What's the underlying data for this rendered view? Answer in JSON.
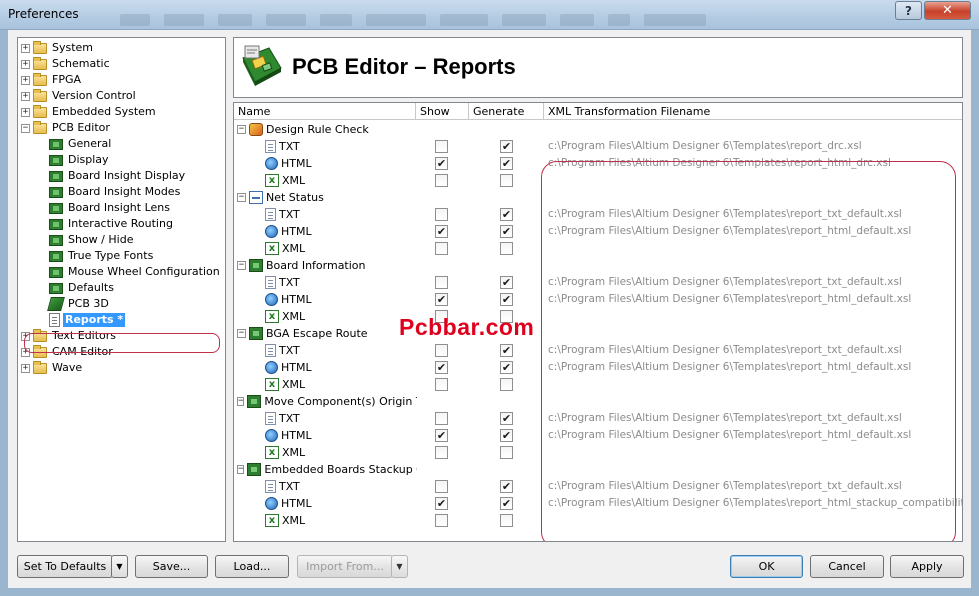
{
  "window": {
    "title": "Preferences"
  },
  "tree": {
    "items": [
      {
        "label": "System",
        "kind": "folder",
        "expander": "+",
        "depth": 0
      },
      {
        "label": "Schematic",
        "kind": "folder",
        "expander": "+",
        "depth": 0
      },
      {
        "label": "FPGA",
        "kind": "folder",
        "expander": "+",
        "depth": 0
      },
      {
        "label": "Version Control",
        "kind": "folder",
        "expander": "+",
        "depth": 0
      },
      {
        "label": "Embedded System",
        "kind": "folder",
        "expander": "+",
        "depth": 0
      },
      {
        "label": "PCB Editor",
        "kind": "folder",
        "expander": "−",
        "depth": 0
      },
      {
        "label": "General",
        "kind": "chip",
        "depth": 1
      },
      {
        "label": "Display",
        "kind": "chip",
        "depth": 1
      },
      {
        "label": "Board Insight Display",
        "kind": "chip",
        "depth": 1
      },
      {
        "label": "Board Insight Modes",
        "kind": "chip",
        "depth": 1
      },
      {
        "label": "Board Insight Lens",
        "kind": "chip",
        "depth": 1
      },
      {
        "label": "Interactive Routing",
        "kind": "chip",
        "depth": 1
      },
      {
        "label": "Show / Hide",
        "kind": "chip",
        "depth": 1
      },
      {
        "label": "True Type Fonts",
        "kind": "chip",
        "depth": 1
      },
      {
        "label": "Mouse Wheel Configuration",
        "kind": "chip",
        "depth": 1
      },
      {
        "label": "Defaults",
        "kind": "chip",
        "depth": 1
      },
      {
        "label": "PCB 3D",
        "kind": "pcb3d",
        "depth": 1
      },
      {
        "label": "Reports *",
        "kind": "doc",
        "depth": 1,
        "selected": true
      },
      {
        "label": "Text Editors",
        "kind": "folder",
        "expander": "+",
        "depth": 0
      },
      {
        "label": "CAM Editor",
        "kind": "folder",
        "expander": "+",
        "depth": 0
      },
      {
        "label": "Wave",
        "kind": "folder",
        "expander": "+",
        "depth": 0
      }
    ]
  },
  "header": {
    "title": "PCB Editor – Reports"
  },
  "grid": {
    "columns": {
      "name": "Name",
      "show": "Show",
      "generate": "Generate",
      "xml": "XML Transformation Filename"
    },
    "groups": [
      {
        "name": "Design Rule Check",
        "icon": "drc-icon",
        "rows": [
          {
            "format": "TXT",
            "show": false,
            "generate": true,
            "path": "c:\\Program Files\\Altium Designer 6\\Templates\\report_drc.xsl"
          },
          {
            "format": "HTML",
            "show": true,
            "generate": true,
            "path": "c:\\Program Files\\Altium Designer 6\\Templates\\report_html_drc.xsl"
          },
          {
            "format": "XML",
            "show": false,
            "generate": false,
            "path": ""
          }
        ]
      },
      {
        "name": "Net Status",
        "icon": "net-status-icon",
        "rows": [
          {
            "format": "TXT",
            "show": false,
            "generate": true,
            "path": "c:\\Program Files\\Altium Designer 6\\Templates\\report_txt_default.xsl"
          },
          {
            "format": "HTML",
            "show": true,
            "generate": true,
            "path": "c:\\Program Files\\Altium Designer 6\\Templates\\report_html_default.xsl"
          },
          {
            "format": "XML",
            "show": false,
            "generate": false,
            "path": ""
          }
        ]
      },
      {
        "name": "Board Information",
        "icon": "board-icon",
        "rows": [
          {
            "format": "TXT",
            "show": false,
            "generate": true,
            "path": "c:\\Program Files\\Altium Designer 6\\Templates\\report_txt_default.xsl"
          },
          {
            "format": "HTML",
            "show": true,
            "generate": true,
            "path": "c:\\Program Files\\Altium Designer 6\\Templates\\report_html_default.xsl"
          },
          {
            "format": "XML",
            "show": false,
            "generate": false,
            "path": ""
          }
        ]
      },
      {
        "name": "BGA Escape Route",
        "icon": "board-icon",
        "rows": [
          {
            "format": "TXT",
            "show": false,
            "generate": true,
            "path": "c:\\Program Files\\Altium Designer 6\\Templates\\report_txt_default.xsl"
          },
          {
            "format": "HTML",
            "show": true,
            "generate": true,
            "path": "c:\\Program Files\\Altium Designer 6\\Templates\\report_html_default.xsl"
          },
          {
            "format": "XML",
            "show": false,
            "generate": false,
            "path": ""
          }
        ]
      },
      {
        "name": "Move Component(s) Origin To G",
        "icon": "board-icon",
        "rows": [
          {
            "format": "TXT",
            "show": false,
            "generate": true,
            "path": "c:\\Program Files\\Altium Designer 6\\Templates\\report_txt_default.xsl"
          },
          {
            "format": "HTML",
            "show": true,
            "generate": true,
            "path": "c:\\Program Files\\Altium Designer 6\\Templates\\report_html_default.xsl"
          },
          {
            "format": "XML",
            "show": false,
            "generate": false,
            "path": ""
          }
        ]
      },
      {
        "name": "Embedded Boards Stackup Co",
        "icon": "board-icon",
        "rows": [
          {
            "format": "TXT",
            "show": false,
            "generate": true,
            "path": "c:\\Program Files\\Altium Designer 6\\Templates\\report_txt_default.xsl"
          },
          {
            "format": "HTML",
            "show": true,
            "generate": true,
            "path": "c:\\Program Files\\Altium Designer 6\\Templates\\report_html_stackup_compatibility.xsl"
          },
          {
            "format": "XML",
            "show": false,
            "generate": false,
            "path": ""
          }
        ]
      }
    ]
  },
  "watermark": "Pcbbar.com",
  "buttons": {
    "set_defaults": "Set To Defaults",
    "save": "Save...",
    "load": "Load...",
    "import_from": "Import From...",
    "ok": "OK",
    "cancel": "Cancel",
    "apply": "Apply"
  },
  "colors": {
    "selection": "#3399ff",
    "annotation": "#c0304a",
    "watermark": "#e0001e"
  }
}
